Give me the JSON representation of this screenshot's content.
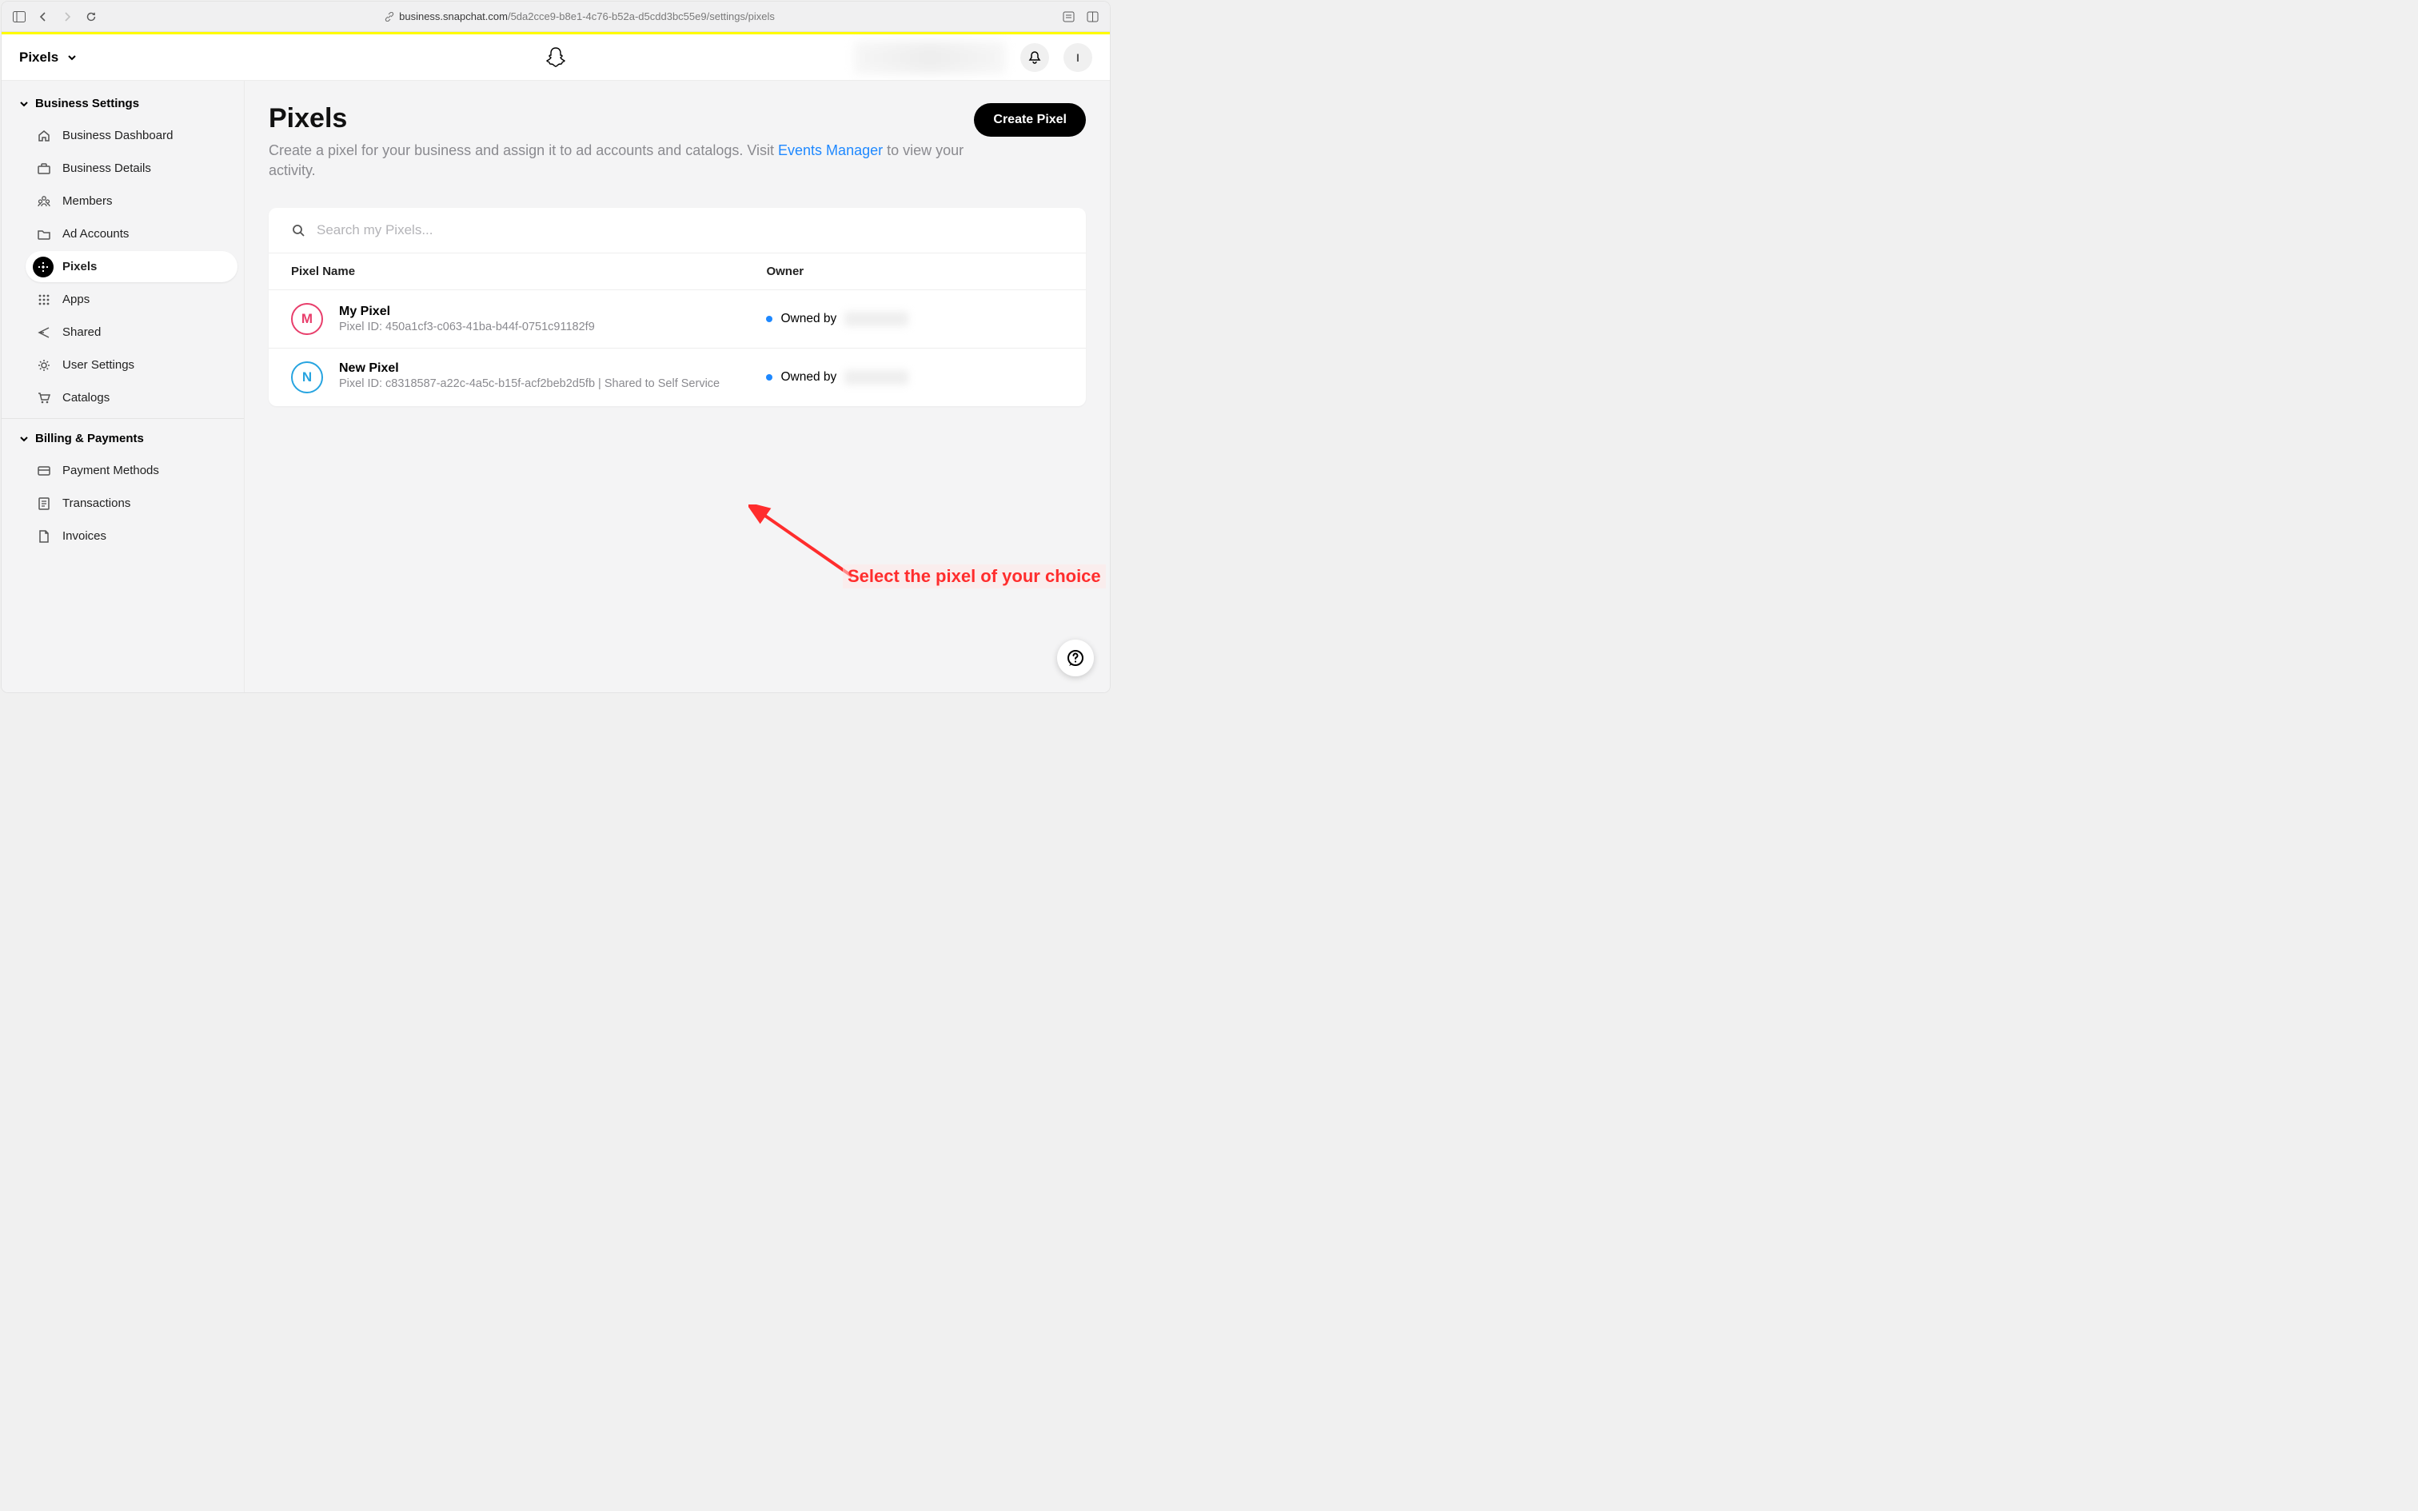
{
  "browser": {
    "url_domain": "business.snapchat.com",
    "url_path": "/5da2cce9-b8e1-4c76-b52a-d5cdd3bc55e9/settings/pixels"
  },
  "app_bar": {
    "context_label": "Pixels",
    "avatar_initial": "I"
  },
  "sidebar": {
    "sections": [
      {
        "title": "Business Settings"
      },
      {
        "title": "Billing & Payments"
      }
    ],
    "business_items": [
      {
        "label": "Business Dashboard"
      },
      {
        "label": "Business Details"
      },
      {
        "label": "Members"
      },
      {
        "label": "Ad Accounts"
      },
      {
        "label": "Pixels"
      },
      {
        "label": "Apps"
      },
      {
        "label": "Shared"
      },
      {
        "label": "User Settings"
      },
      {
        "label": "Catalogs"
      }
    ],
    "billing_items": [
      {
        "label": "Payment Methods"
      },
      {
        "label": "Transactions"
      },
      {
        "label": "Invoices"
      }
    ]
  },
  "page": {
    "title": "Pixels",
    "subtitle_a": "Create a pixel for your business and assign it to ad accounts and catalogs. Visit ",
    "subtitle_link": "Events Manager",
    "subtitle_b": " to view your activity.",
    "create_btn": "Create Pixel",
    "search_placeholder": "Search my Pixels...",
    "columns": {
      "name": "Pixel Name",
      "owner": "Owner"
    },
    "rows": [
      {
        "initial": "M",
        "avatar_class": "pa-pink",
        "name": "My Pixel",
        "sub": "Pixel ID: 450a1cf3-c063-41ba-b44f-0751c91182f9",
        "owner_label": "Owned by"
      },
      {
        "initial": "N",
        "avatar_class": "pa-blue",
        "name": "New Pixel",
        "sub": "Pixel ID: c8318587-a22c-4a5c-b15f-acf2beb2d5fb | Shared to             Self Service",
        "owner_label": "Owned by"
      }
    ]
  },
  "annotation": {
    "text": "Select the pixel of your choice"
  }
}
